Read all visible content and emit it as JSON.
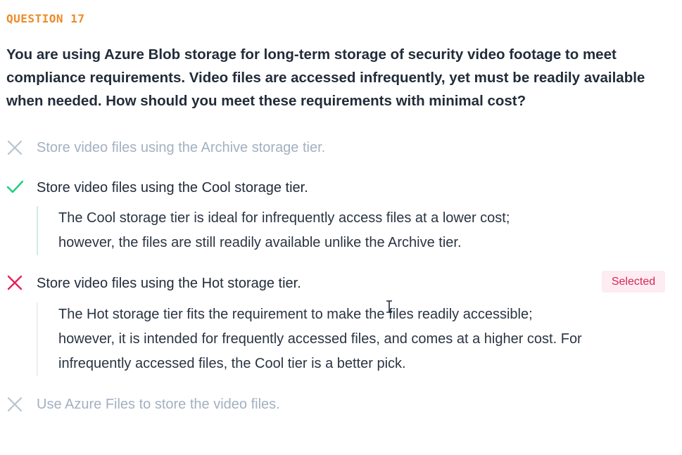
{
  "question": {
    "label": "QUESTION 17",
    "text": "You are using Azure Blob storage for long-term storage of security video footage to meet compliance requirements. Video files are accessed infrequently, yet must be readily available when needed. How should you meet these requirements with minimal cost?"
  },
  "answers": [
    {
      "text": "Store video files using the Archive storage tier.",
      "status": "incorrect-unselected",
      "icon": "x-icon"
    },
    {
      "text": "Store video files using the Cool storage tier.",
      "status": "correct",
      "icon": "check-icon",
      "explanation": "The Cool storage tier is ideal for infrequently access files at a lower cost; however, the files are still readily available unlike the Archive tier."
    },
    {
      "text": "Store video files using the Hot storage tier.",
      "status": "incorrect-selected",
      "icon": "x-icon",
      "badge": "Selected",
      "explanation": "The Hot storage tier fits the requirement to make the files readily accessible; however, it is intended for frequently accessed files, and comes at a higher cost. For infrequently accessed files, the Cool tier is a better pick."
    },
    {
      "text": "Use Azure Files to store the video files.",
      "status": "incorrect-unselected",
      "icon": "x-icon"
    }
  ],
  "colors": {
    "question_label": "#ef8a26",
    "correct": "#1fcb7e",
    "incorrect_selected": "#e5215d",
    "muted": "#b9c3d0",
    "badge_bg": "#fdecf1",
    "badge_text": "#d3285a"
  }
}
